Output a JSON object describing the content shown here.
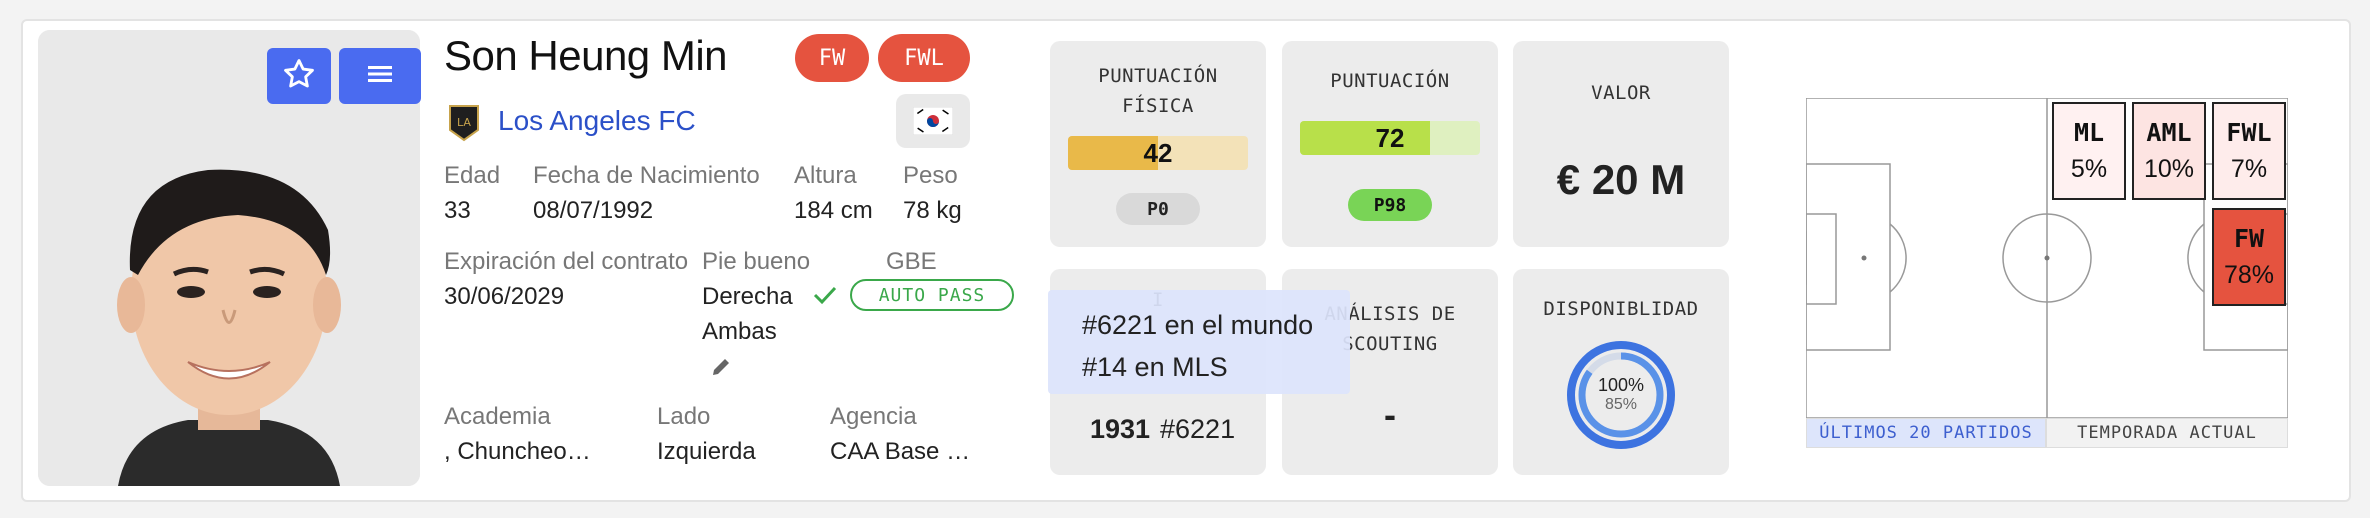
{
  "player": {
    "name": "Son Heung Min",
    "positions": [
      "FW",
      "FWL"
    ],
    "club": "Los Angeles FC",
    "flag": "🇰🇷"
  },
  "buttons": {
    "favorite_icon": "star-icon",
    "menu_icon": "hamburger-menu-icon"
  },
  "details": {
    "age_label": "Edad",
    "age": "33",
    "dob_label": "Fecha de Nacimiento",
    "dob": "08/07/1992",
    "height_label": "Altura",
    "height": "184 cm",
    "weight_label": "Peso",
    "weight": "78 kg",
    "contract_label": "Expiración del contrato",
    "contract": "30/06/2029",
    "foot_label": "Pie bueno",
    "foot_primary": "Derecha",
    "foot_secondary": "Ambas",
    "gbe_label": "GBE",
    "gbe_value": "AUTO PASS",
    "academy_label": "Academia",
    "academy": ", Chuncheo…",
    "side_label": "Lado",
    "side": "Izquierda",
    "agency_label": "Agencia",
    "agency": "CAA Base …"
  },
  "tiles": {
    "physical": {
      "title": "PUNTUACIÓN FÍSICA",
      "value": "42",
      "fraction": 0.5,
      "pill": "P0",
      "color": "#e9b949"
    },
    "score": {
      "title": "PUNTUACIÓN",
      "value": "72",
      "fraction": 0.72,
      "pill": "P98",
      "color": "#b8e04a"
    },
    "value": {
      "title": "VALOR",
      "amount": "€ 20 M"
    },
    "ranking": {
      "title": "I",
      "rank_num": "1931",
      "rank_world": "#6221"
    },
    "scouting": {
      "title": "ANÁLISIS DE SCOUTING",
      "value": "-"
    },
    "availability": {
      "title": "DISPONIBLIDAD",
      "outer": "100%",
      "inner": "85%",
      "outer_frac": 1.0,
      "inner_frac": 0.85
    }
  },
  "tooltip": {
    "line1": "#6221 en el mundo",
    "line2": "#14 en MLS"
  },
  "pitch": {
    "zones": [
      {
        "label": "ML",
        "pct": "5%",
        "color": "#fff1f1"
      },
      {
        "label": "AML",
        "pct": "10%",
        "color": "#fde4e2"
      },
      {
        "label": "FWL",
        "pct": "7%",
        "color": "#feeceb"
      },
      {
        "label": "FW",
        "pct": "78%",
        "color": "#e5533f"
      }
    ],
    "tabs": [
      "ÚLTIMOS 20 PARTIDOS",
      "TEMPORADA ACTUAL"
    ]
  },
  "colors": {
    "accent": "#4a6bf0",
    "badge": "#e5533f",
    "success": "#3aa84a",
    "link": "#2b50c8"
  }
}
